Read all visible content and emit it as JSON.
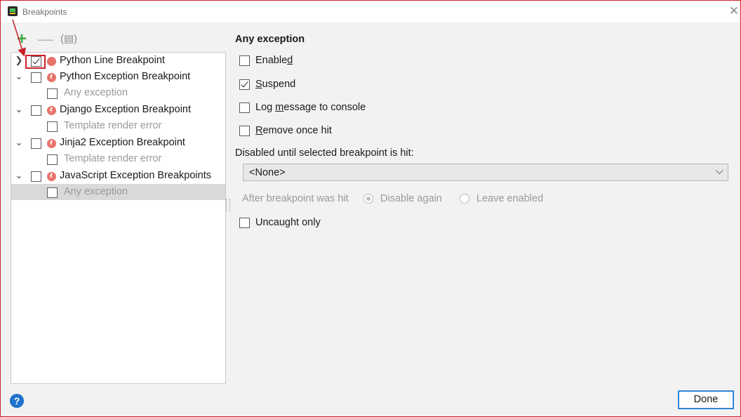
{
  "window": {
    "title": "Breakpoints"
  },
  "toolbar": {
    "add_icon": "plus-icon",
    "remove_icon": "minus-icon",
    "group_icon": "group-by-icon"
  },
  "tree": [
    {
      "label": "Python Line Breakpoint",
      "expanded": false,
      "checked": true
    },
    {
      "label": "Python Exception Breakpoint",
      "expanded": true,
      "checked": false
    },
    {
      "label": "Any exception",
      "checked": false
    },
    {
      "label": "Django Exception Breakpoint",
      "expanded": true,
      "checked": false
    },
    {
      "label": "Template render error",
      "checked": false
    },
    {
      "label": "Jinja2 Exception Breakpoint",
      "expanded": true,
      "checked": false
    },
    {
      "label": "Template render error",
      "checked": false
    },
    {
      "label": "JavaScript Exception Breakpoints",
      "expanded": true,
      "checked": false
    },
    {
      "label": "Any exception",
      "checked": false,
      "selected": true
    }
  ],
  "details": {
    "heading": "Any exception",
    "enabled": {
      "label_pre": "Enable",
      "label_mnemonic": "d",
      "label_post": "",
      "checked": false
    },
    "suspend": {
      "label_pre": "",
      "label_mnemonic": "S",
      "label_post": "uspend",
      "checked": true
    },
    "log_message": {
      "label_pre": "Log ",
      "label_mnemonic": "m",
      "label_post": "essage to console",
      "checked": false
    },
    "remove_once_hit": {
      "label_pre": "",
      "label_mnemonic": "R",
      "label_post": "emove once hit",
      "checked": false
    },
    "disabled_until_label": "Disabled until selected breakpoint is hit:",
    "dropdown_value": "<None>",
    "after_hit_label": "After breakpoint was hit",
    "disable_again_label": "Disable again",
    "leave_enabled_label": "Leave enabled",
    "uncaught_only": {
      "label": "Uncaught only",
      "checked": false
    }
  },
  "footer": {
    "help_label": "?",
    "done_label": "Done"
  },
  "colors": {
    "highlight_red": "#cc1f28",
    "accent_blue": "#2f86d6",
    "add_green": "#3fa845",
    "breakpoint_red": "#e9736a"
  }
}
